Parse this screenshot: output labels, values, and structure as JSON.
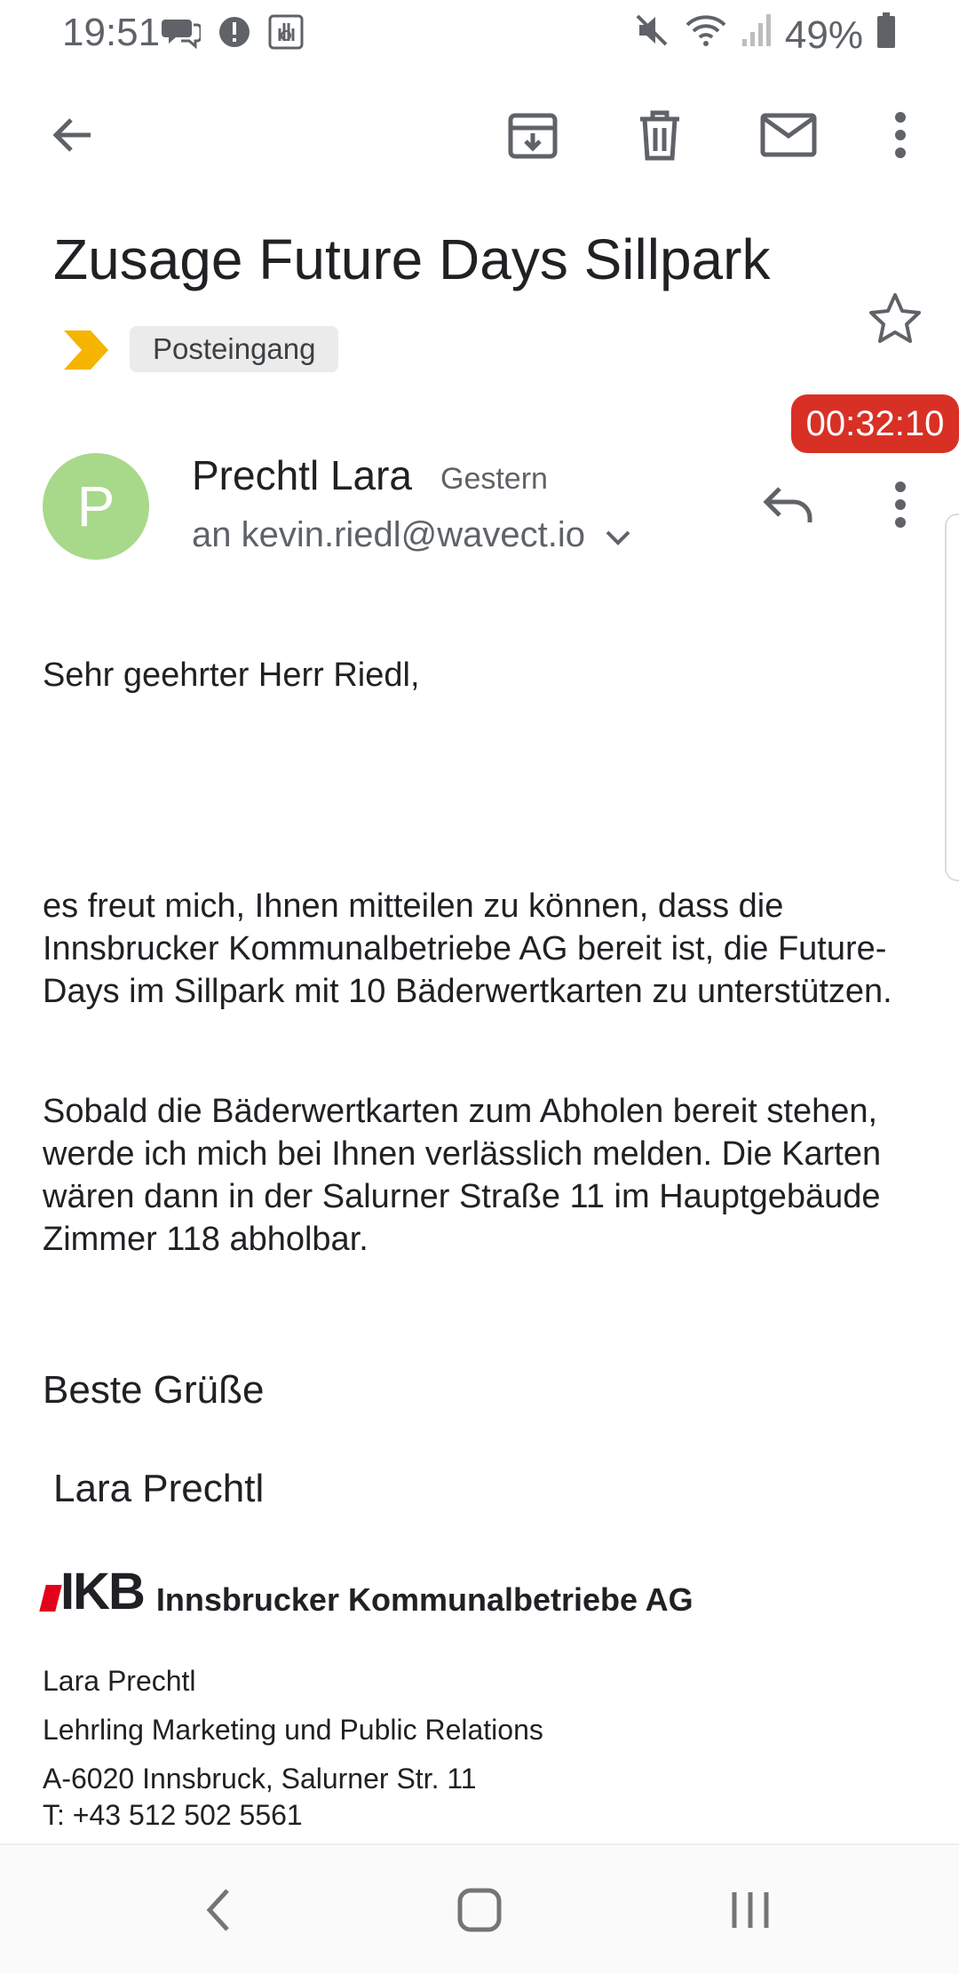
{
  "status_bar": {
    "time": "19:51",
    "battery": "49%"
  },
  "toolbar": {
    "back_icon": "arrow-left-icon",
    "archive_icon": "archive-icon",
    "delete_icon": "trash-icon",
    "mark_unread_icon": "mail-icon",
    "more_icon": "more-vert-icon"
  },
  "email": {
    "subject": "Zusage Future Days Sillpark",
    "label": "Posteingang",
    "sender": "Prechtl Lara",
    "date": "Gestern",
    "recipient": "an kevin.riedl@wavect.io",
    "avatar_letter": "P",
    "greeting": "Sehr geehrter Herr Riedl,",
    "paragraph1": "es freut mich, Ihnen mitteilen zu können, dass die Innsbrucker Kommunalbetriebe AG bereit ist, die Future-Days im Sillpark mit 10 Bäderwertkarten zu unterstützen.",
    "paragraph2": "Sobald die Bäderwertkarten zum Abholen bereit stehen, werde ich mich bei Ihnen verlässlich melden. Die Karten wären dann in der Salurner Straße 11 im Hauptgebäude Zimmer 118 abholbar.",
    "closing": "Beste Grüße",
    "signature_name": "Lara Prechtl"
  },
  "signature": {
    "logo_text": "IKB",
    "company": "Innsbrucker Kommunalbetriebe AG",
    "name": "Lara Prechtl",
    "role": "Lehrling Marketing und Public Relations",
    "address": "A-6020 Innsbruck, Salurner Str. 11",
    "phone": "T: +43 512 502 5561"
  },
  "overlay": {
    "timer": "00:32:10"
  },
  "colors": {
    "timer_bg": "#d93025",
    "avatar_bg": "#a8d98a",
    "importance_marker": "#f5b400",
    "logo_red": "#e3001b"
  }
}
